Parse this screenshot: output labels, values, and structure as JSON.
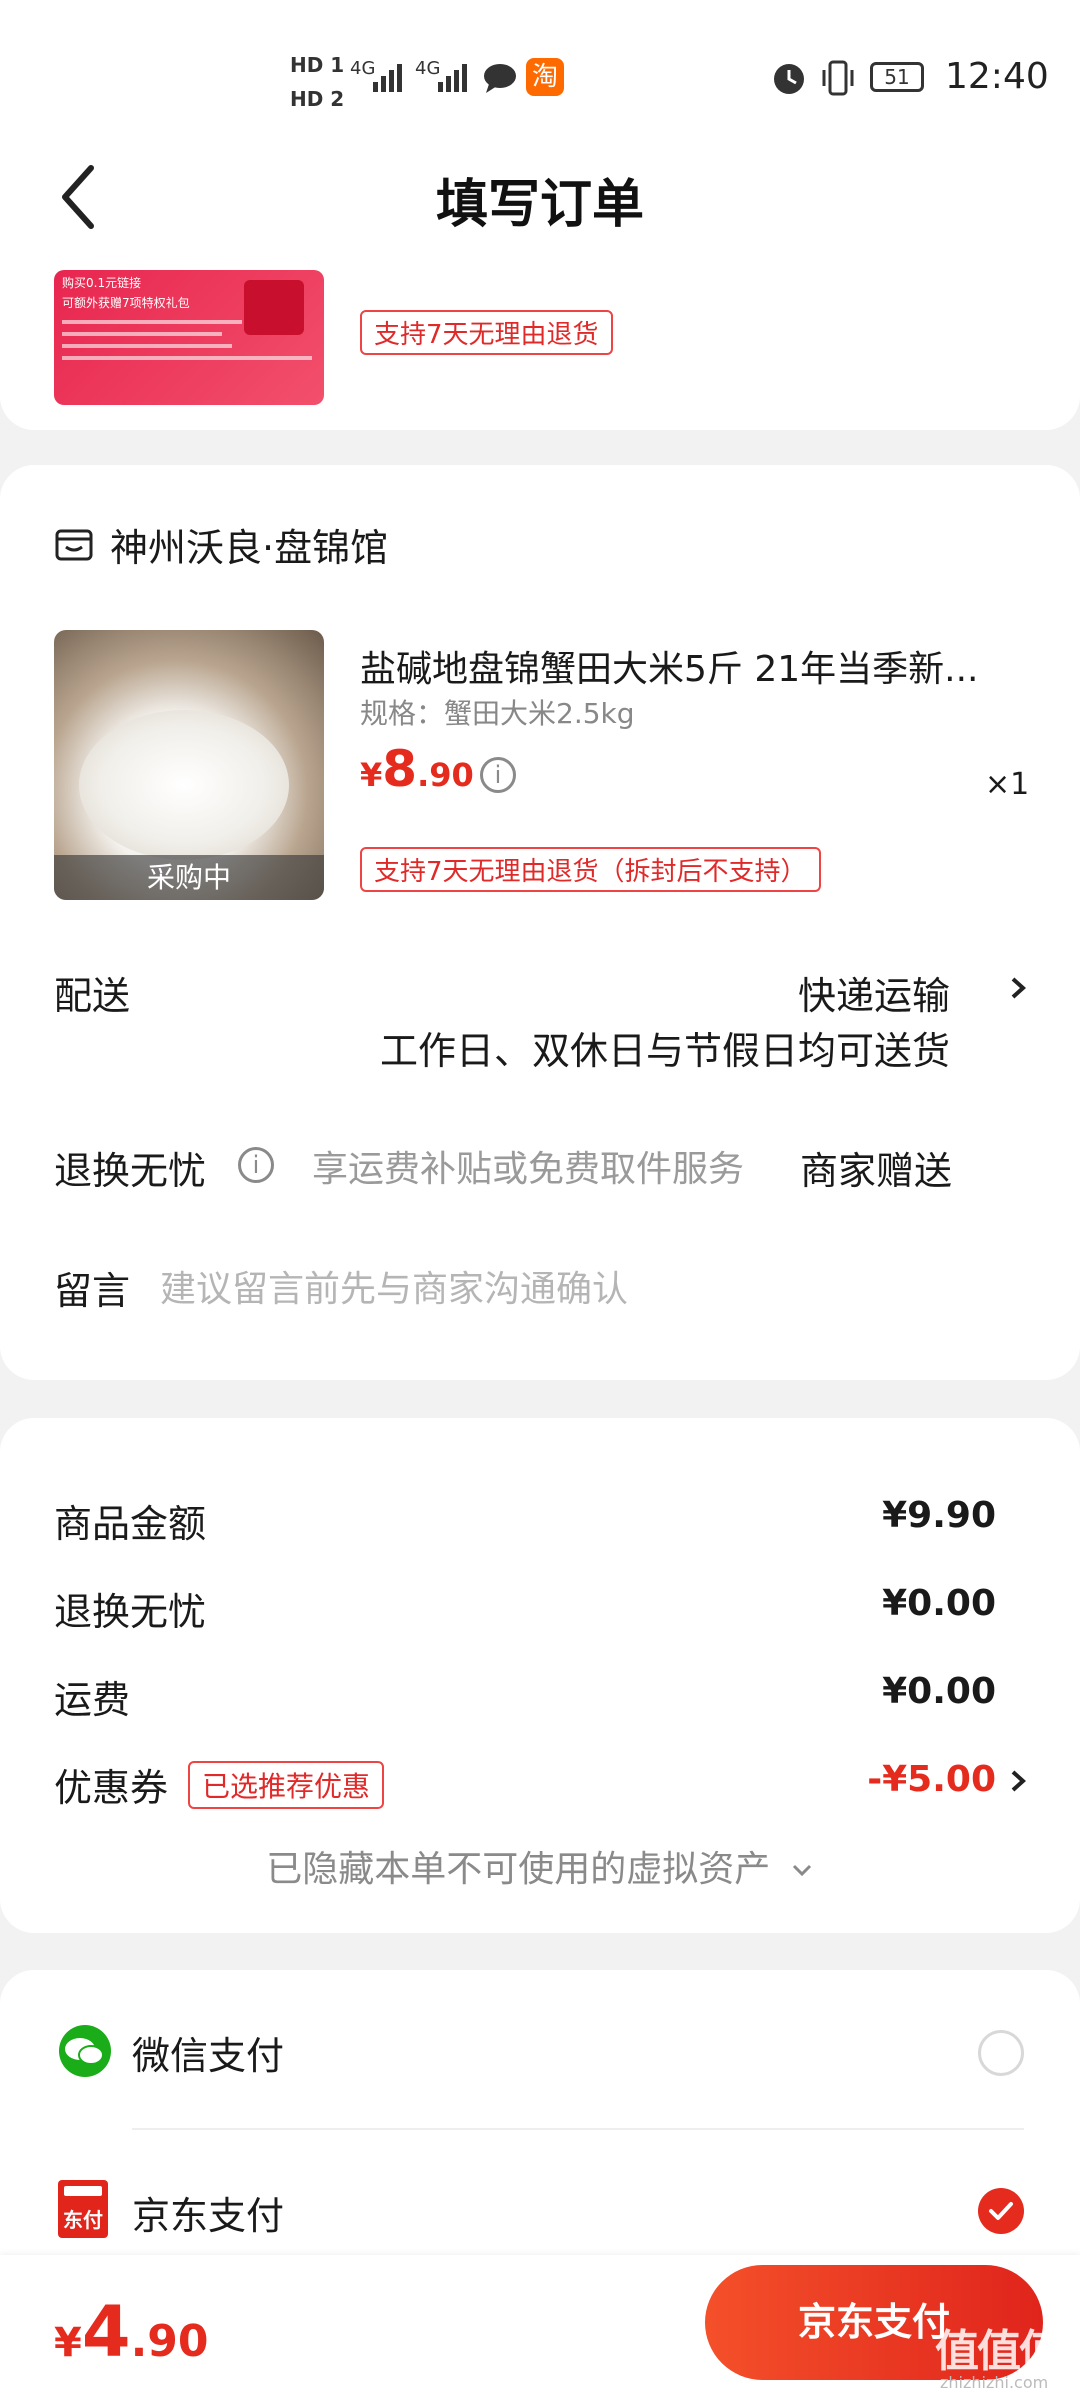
{
  "status_bar": {
    "hd1": "HD 1",
    "hd2": "HD 2",
    "net1": "4G",
    "net2": "4G",
    "taobao_badge": "淘",
    "battery": "51",
    "time": "12:40"
  },
  "header": {
    "title": "填写订单"
  },
  "top_product": {
    "thumb_line1": "购买0.1元链接",
    "thumb_line2": "可额外获赠7项特权礼包",
    "return_tag": "支持7天无理由退货"
  },
  "shop": {
    "name": "神州沃良·盘锦馆",
    "product": {
      "title": "盐碱地盘锦蟹田大米5斤 21年当季新...",
      "spec": "规格：蟹田大米2.5kg",
      "price_symbol": "¥",
      "price_int": "8",
      "price_dec": ".90",
      "qty": "×1",
      "overlay": "采购中",
      "return_tag": "支持7天无理由退货（拆封后不支持）"
    },
    "delivery": {
      "label": "配送",
      "method": "快递运输",
      "note": "工作日、双休日与节假日均可送货"
    },
    "worry_free": {
      "label": "退换无忧",
      "desc": "享运费补贴或免费取件服务",
      "value": "商家赠送"
    },
    "message": {
      "label": "留言",
      "placeholder": "建议留言前先与商家沟通确认"
    }
  },
  "summary": {
    "goods_label": "商品金额",
    "goods_value": "¥9.90",
    "worry_label": "退换无忧",
    "worry_value": "¥0.00",
    "shipping_label": "运费",
    "shipping_value": "¥0.00",
    "coupon_label": "优惠券",
    "coupon_tag": "已选推荐优惠",
    "coupon_value": "-¥5.00",
    "hidden_assets": "已隐藏本单不可使用的虚拟资产"
  },
  "payment": {
    "wechat_label": "微信支付",
    "jd_label": "京东支付",
    "jd_icon_text": "东付",
    "selected": "jd"
  },
  "bottom_bar": {
    "total_symbol": "¥",
    "total_int": "4",
    "total_dec": ".90",
    "pay_button": "京东支付",
    "watermark": "值值值",
    "watermark_url": "zhizhizhi.com"
  },
  "colors": {
    "accent_red": "#e52a1e",
    "wechat_green": "#1aad19",
    "pay_button_gradient": [
      "#f4502a",
      "#e0241c"
    ]
  }
}
